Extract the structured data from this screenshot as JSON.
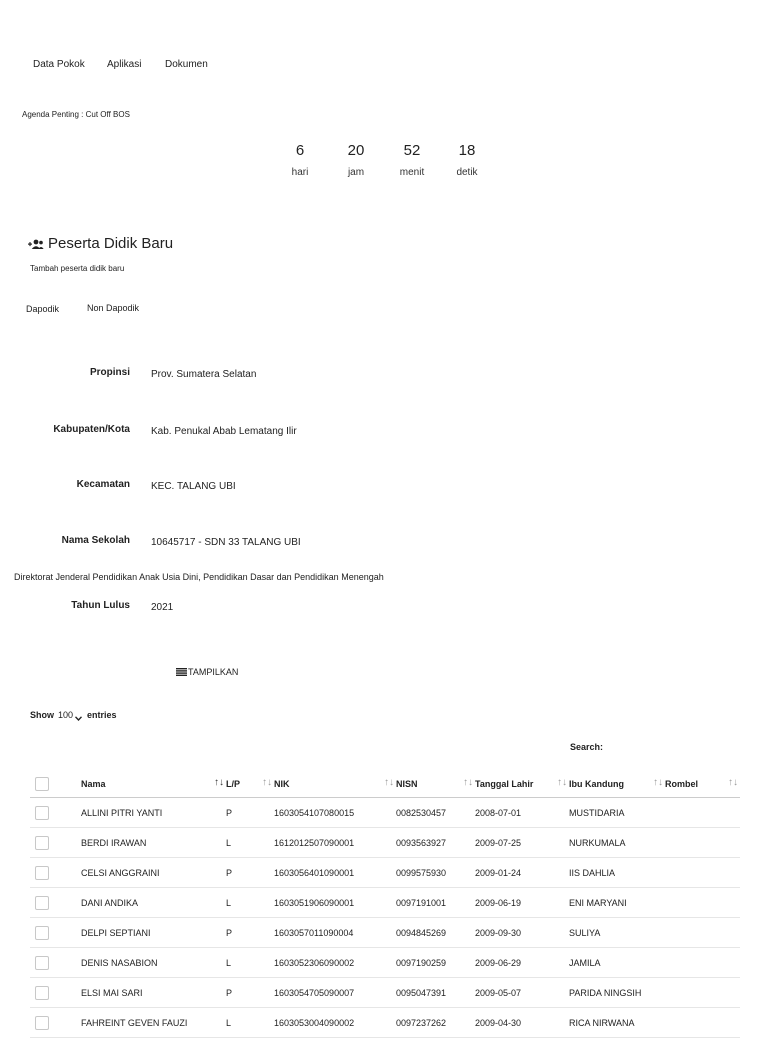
{
  "nav": [
    "Data Pokok",
    "Aplikasi",
    "Dokumen"
  ],
  "agenda": "Agenda Penting : Cut Off BOS",
  "countdown": [
    {
      "value": "6",
      "unit": "hari"
    },
    {
      "value": "20",
      "unit": "jam"
    },
    {
      "value": "52",
      "unit": "menit"
    },
    {
      "value": "18",
      "unit": "detik"
    }
  ],
  "section": {
    "title": "Peserta Didik Baru",
    "subtitle": "Tambah peserta didik baru",
    "tabs": [
      "Dapodik",
      "Non Dapodik"
    ]
  },
  "form": {
    "propinsi_label": "Propinsi",
    "propinsi_value": "Prov. Sumatera Selatan",
    "kabupaten_label": "Kabupaten/Kota",
    "kabupaten_value": "Kab. Penukal Abab Lematang Ilir",
    "kecamatan_label": "Kecamatan",
    "kecamatan_value": "KEC. TALANG UBI",
    "sekolah_label": "Nama Sekolah",
    "sekolah_value": "10645717 - SDN 33 TALANG UBI",
    "directorate": "Direktorat Jenderal Pendidikan Anak Usia Dini, Pendidikan Dasar dan Pendidikan Menengah",
    "tahun_label": "Tahun Lulus",
    "tahun_value": "2021",
    "submit": "TAMPILKAN"
  },
  "table_controls": {
    "show": "Show",
    "entries_value": "100",
    "entries": "entries",
    "search": "Search:"
  },
  "table": {
    "headers": [
      "Nama",
      "L/P",
      "NIK",
      "NISN",
      "Tanggal Lahir",
      "Ibu Kandung",
      "Rombel"
    ],
    "rows": [
      [
        "ALLINI PITRI YANTI",
        "P",
        "1603054107080015",
        "0082530457",
        "2008-07-01",
        "MUSTIDARIA",
        ""
      ],
      [
        "BERDI IRAWAN",
        "L",
        "1612012507090001",
        "0093563927",
        "2009-07-25",
        "NURKUMALA",
        ""
      ],
      [
        "CELSI ANGGRAINI",
        "P",
        "1603056401090001",
        "0099575930",
        "2009-01-24",
        "IIS DAHLIA",
        ""
      ],
      [
        "DANI ANDIKA",
        "L",
        "1603051906090001",
        "0097191001",
        "2009-06-19",
        "ENI MARYANI",
        ""
      ],
      [
        "DELPI SEPTIANI",
        "P",
        "1603057011090004",
        "0094845269",
        "2009-09-30",
        "SULIYA",
        ""
      ],
      [
        "DENIS NASABION",
        "L",
        "1603052306090002",
        "0097190259",
        "2009-06-29",
        "JAMILA",
        ""
      ],
      [
        "ELSI MAI SARI",
        "P",
        "1603054705090007",
        "0095047391",
        "2009-05-07",
        "PARIDA NINGSIH",
        ""
      ],
      [
        "FAHREINT GEVEN FAUZI",
        "L",
        "1603053004090002",
        "0097237262",
        "2009-04-30",
        "RICA NIRWANA",
        ""
      ]
    ]
  }
}
